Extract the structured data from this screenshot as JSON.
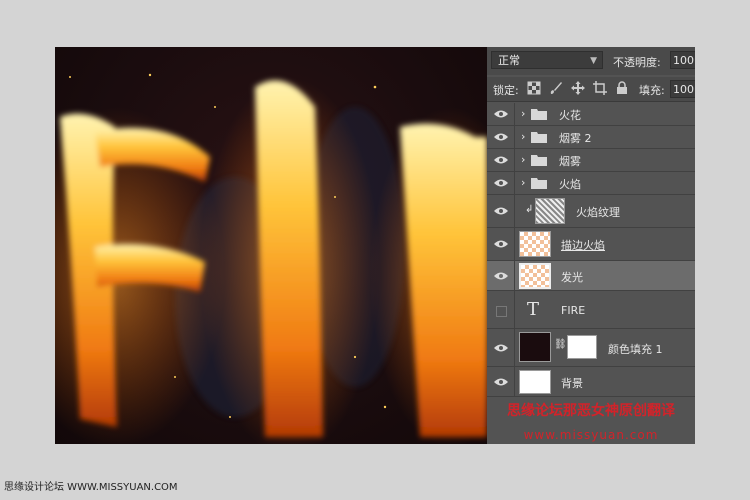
{
  "panel": {
    "blend_mode": "正常",
    "opacity_label": "不透明度:",
    "opacity_value": "100",
    "lock_label": "锁定:",
    "fill_label": "填充:",
    "fill_value": "100",
    "layers": [
      {
        "name": "火花",
        "type": "group",
        "visible": true
      },
      {
        "name": "烟雾 2",
        "type": "group",
        "visible": true
      },
      {
        "name": "烟雾",
        "type": "group",
        "visible": true
      },
      {
        "name": "火焰",
        "type": "group",
        "visible": true
      },
      {
        "name": "火焰纹理",
        "type": "smart-object",
        "visible": true,
        "clipped": true
      },
      {
        "name": "描边火焰",
        "type": "pixel",
        "visible": true
      },
      {
        "name": "发光",
        "type": "smart-object",
        "visible": true,
        "selected": true
      },
      {
        "name": "FIRE",
        "type": "text",
        "visible": false,
        "glyph": "T"
      },
      {
        "name": "颜色填充 1",
        "type": "fill",
        "visible": true
      },
      {
        "name": "背景",
        "type": "background",
        "visible": true
      }
    ]
  },
  "watermark": {
    "line1": "思缘论坛那恶女神原创翻译",
    "line2": "www.missyuan.com"
  },
  "footer": "思缘设计论坛  WWW.MISSYUAN.COM",
  "colors": {
    "panel_bg": "#535353",
    "selected_row": "#6c6c6c",
    "watermark": "#d2232a",
    "fill_swatch": "#1a0c0e"
  },
  "icons": [
    "eye-icon",
    "folder-icon",
    "chevron-right-icon",
    "lock-icon",
    "brush-icon",
    "move-icon",
    "crop-icon",
    "chain-link-icon",
    "clip-arrow-icon"
  ]
}
